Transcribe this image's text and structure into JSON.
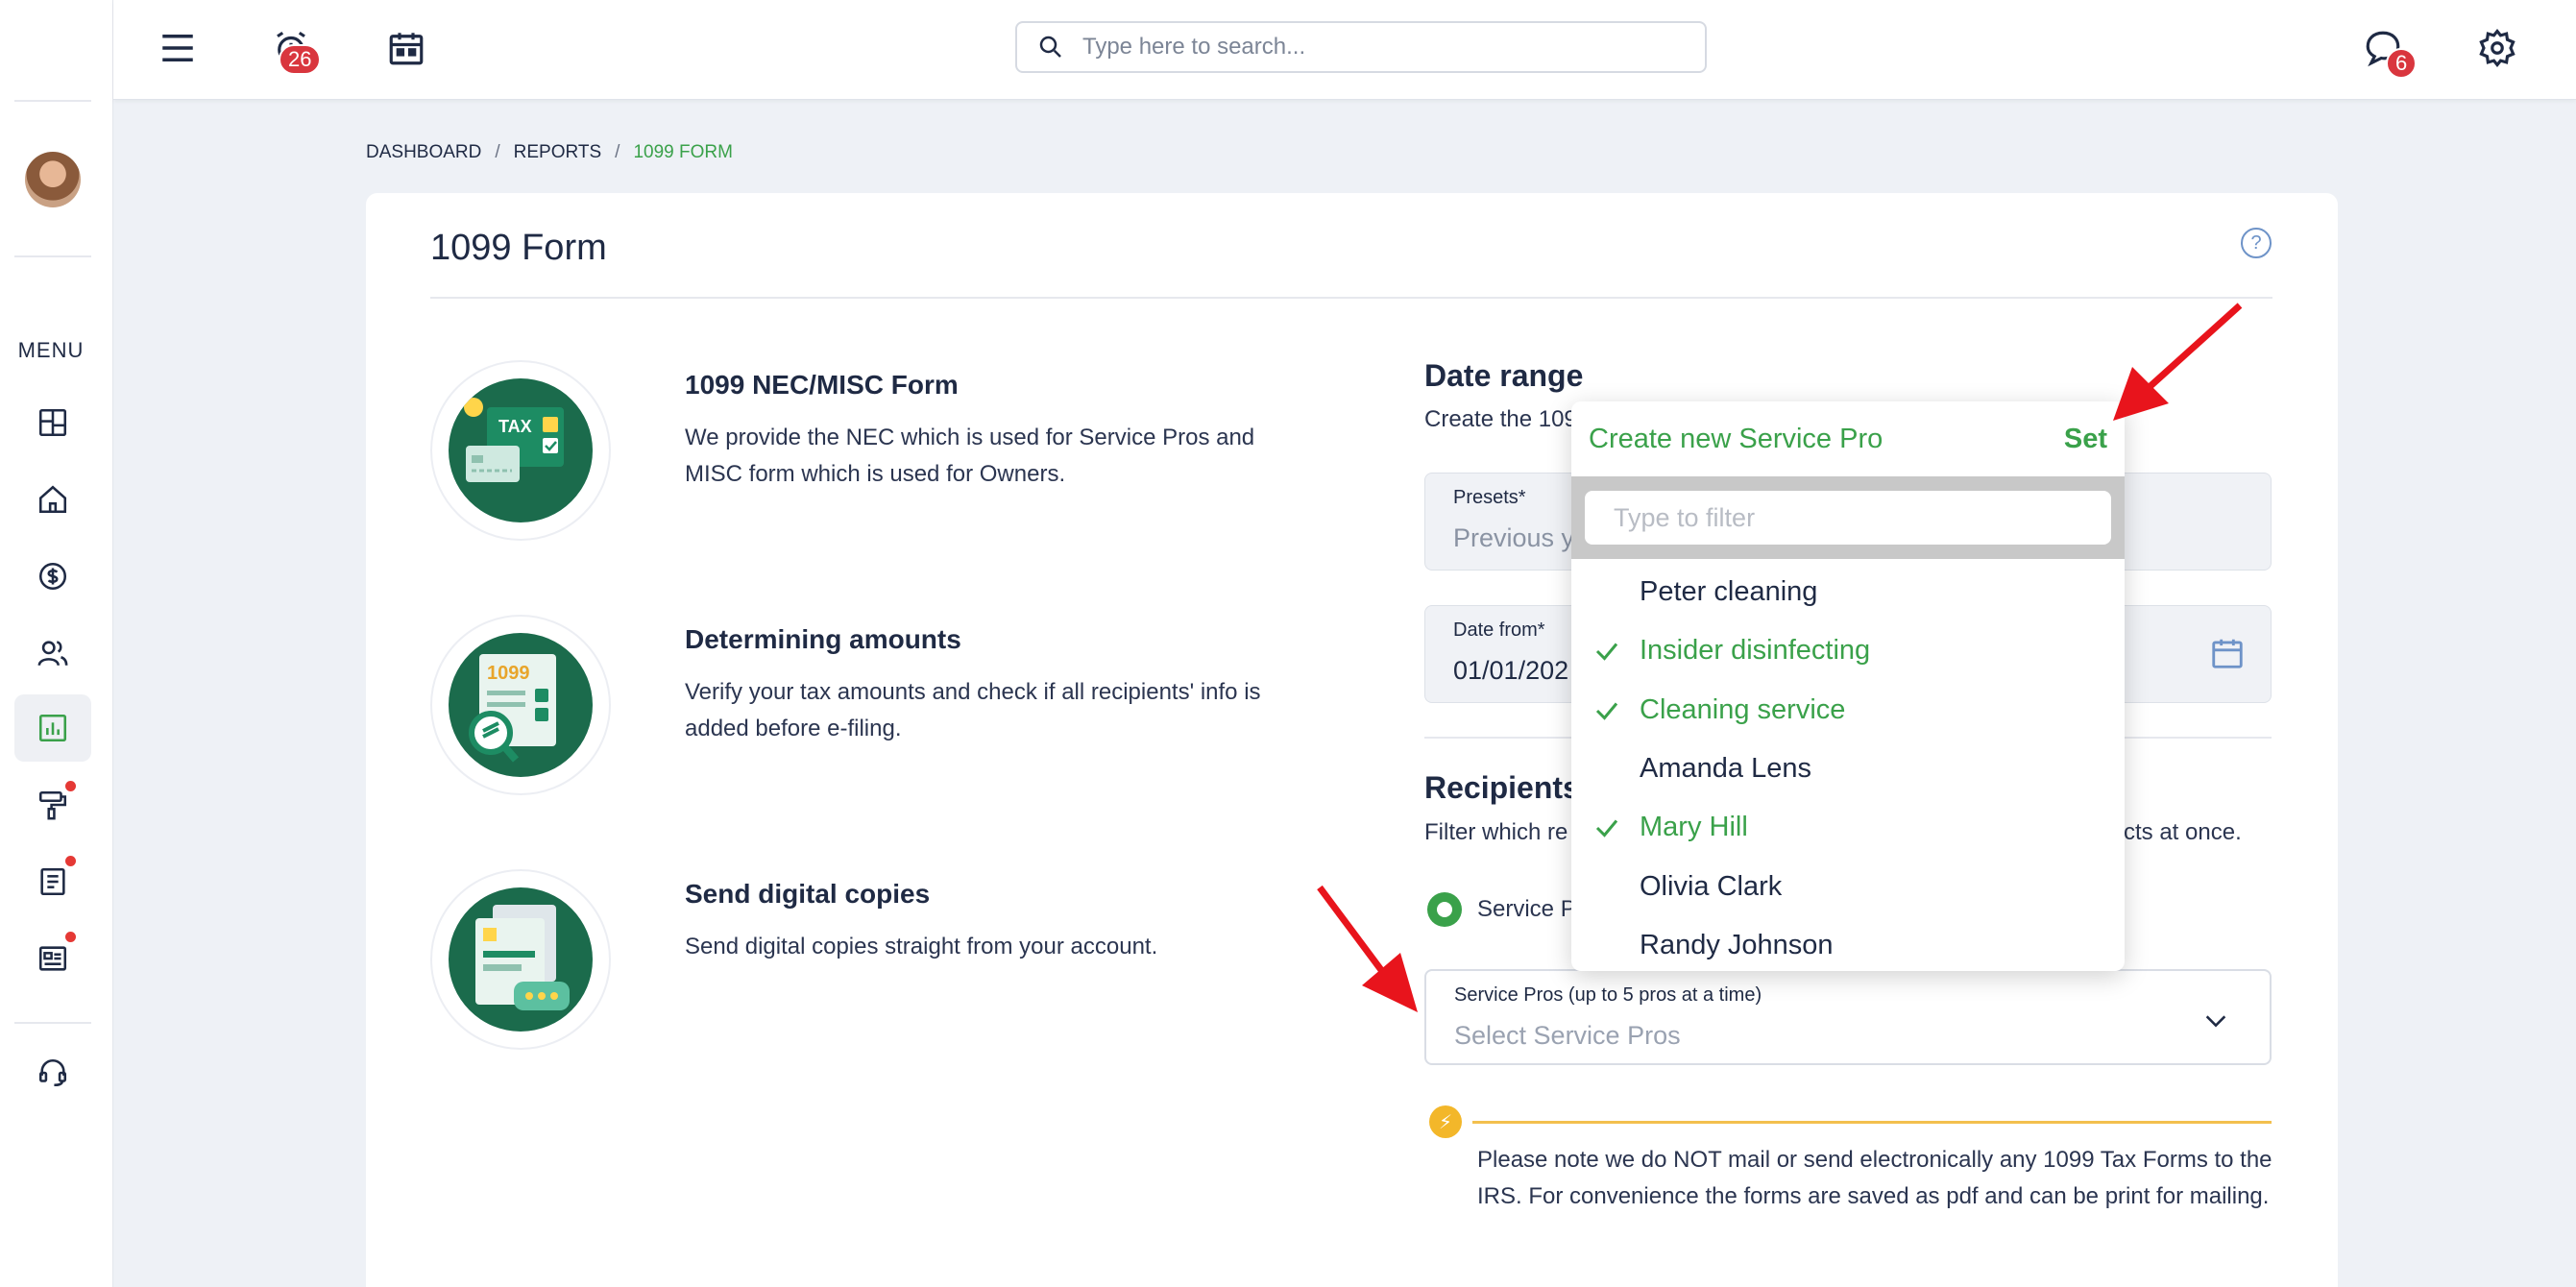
{
  "topbar": {
    "alarm_badge": "26",
    "search_placeholder": "Type here to search...",
    "chat_badge": "6"
  },
  "sidebar": {
    "menu_label": "MENU",
    "items": [
      {
        "icon": "dashboard-icon"
      },
      {
        "icon": "home-icon"
      },
      {
        "icon": "dollar-icon"
      },
      {
        "icon": "users-icon"
      },
      {
        "icon": "reports-icon",
        "active": true
      },
      {
        "icon": "paint-roller-icon",
        "dot": true
      },
      {
        "icon": "document-icon",
        "dot": true
      },
      {
        "icon": "card-icon",
        "dot": true
      },
      {
        "icon": "support-headset-icon"
      }
    ]
  },
  "breadcrumb": {
    "items": [
      "DASHBOARD",
      "REPORTS",
      "1099 FORM"
    ],
    "separator": "/"
  },
  "page": {
    "title": "1099 Form",
    "help": "?"
  },
  "features": [
    {
      "title": "1099 NEC/MISC Form",
      "text": "We provide the NEC which is used for Service Pros and MISC form which is used for Owners.",
      "illustration": "tax-form-illustration"
    },
    {
      "title": "Determining amounts",
      "text": "Verify your tax amounts and check if all recipients' info is added before e-filing.",
      "illustration": "magnifier-1099-illustration"
    },
    {
      "title": "Send digital copies",
      "text": "Send digital copies straight from your account.",
      "illustration": "digital-copies-illustration"
    }
  ],
  "date_range": {
    "title": "Date range",
    "subtitle": "Create the 109",
    "presets_label": "Presets*",
    "presets_value": "Previous y",
    "date_from_label": "Date from*",
    "date_from_value": "01/01/202"
  },
  "recipients": {
    "title": "Recipients",
    "subtitle_left": "Filter which re",
    "subtitle_right": "cts at once.",
    "radio_label": "Service P",
    "select_label": "Service Pros (up to 5 pros at a time)",
    "select_placeholder": "Select Service Pros"
  },
  "note": {
    "text": "Please note we do NOT mail or send electronically any 1099 Tax Forms to the IRS. For convenience the forms are saved as pdf and can be print for mailing."
  },
  "dropdown": {
    "create_label": "Create new Service Pro",
    "set_label": "Set",
    "filter_placeholder": "Type to filter",
    "items": [
      {
        "label": "Peter cleaning",
        "selected": false
      },
      {
        "label": "Insider disinfecting",
        "selected": true
      },
      {
        "label": "Cleaning service",
        "selected": true
      },
      {
        "label": "Amanda Lens",
        "selected": false
      },
      {
        "label": "Mary Hill",
        "selected": true
      },
      {
        "label": "Olivia Clark",
        "selected": false
      },
      {
        "label": "Randy Johnson",
        "selected": false
      }
    ]
  },
  "colors": {
    "accent_green": "#3aa14a",
    "badge_red": "#d9363e",
    "arrow_red": "#e8141c",
    "note_yellow": "#f3b72a"
  }
}
